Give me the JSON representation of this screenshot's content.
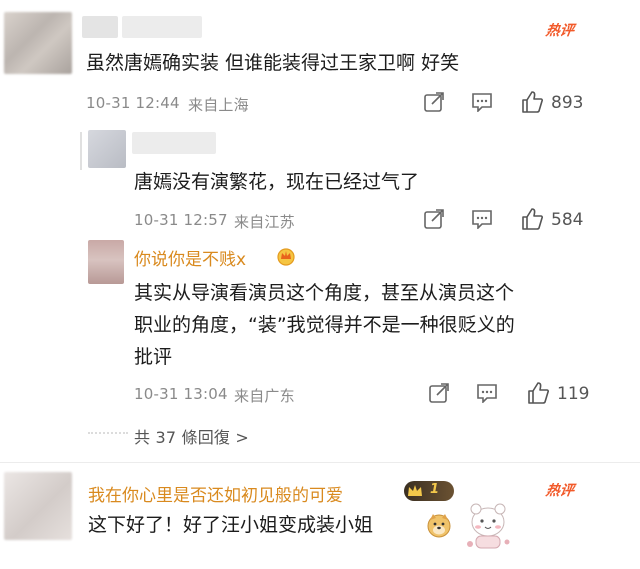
{
  "comments": [
    {
      "badge": "热评",
      "text": "虽然唐嫣确实装 但谁能装得过王家卫啊 好笑",
      "time": "10-31 12:44",
      "location": "来自上海",
      "likes": "893",
      "replies": [
        {
          "text": "唐嫣没有演繁花，现在已经过气了",
          "time": "10-31 12:57",
          "location": "来自江苏",
          "likes": "584"
        },
        {
          "username": "你说你是不贱x",
          "text_line1": "其实从导演看演员这个角度，甚至从演员这个",
          "text_line2": "职业的角度，“装”我觉得并不是一种很贬义的",
          "text_line3": "批评",
          "time": "10-31 13:04",
          "location": "来自广东",
          "likes": "119"
        }
      ],
      "more_replies": "共 37 條回復 >"
    },
    {
      "badge": "热评",
      "username": "我在你心里是否还如初见般的可爱",
      "level_badge": "1",
      "text": "这下好了！好了汪小姐变成装小姐"
    }
  ],
  "colors": {
    "hot": "#f25a2a",
    "username": "#d98a1f",
    "meta": "#8a8a8a"
  },
  "icons": [
    "share-icon",
    "comment-icon",
    "thumbs-up-icon",
    "crown-icon",
    "doge-emoji-icon",
    "sticker-icon"
  ]
}
